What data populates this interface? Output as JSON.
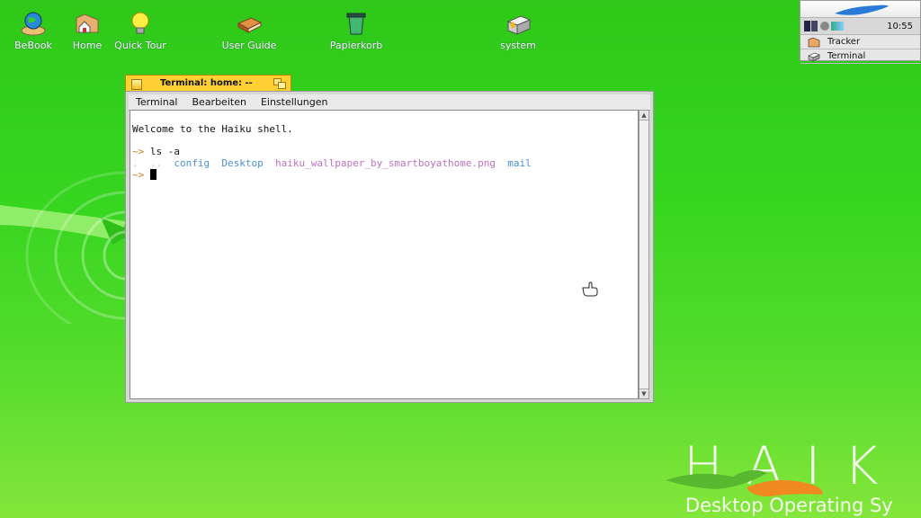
{
  "desktop": {
    "icons": [
      {
        "label": "BeBook",
        "icon": "globe-book-icon"
      },
      {
        "label": "Home",
        "icon": "home-folder-icon"
      },
      {
        "label": "Quick Tour",
        "icon": "lightbulb-icon"
      },
      {
        "label": "User Guide",
        "icon": "book-icon"
      },
      {
        "label": "Papierkorb",
        "icon": "trash-icon"
      },
      {
        "label": "system",
        "icon": "system-volume-icon"
      }
    ],
    "logo": {
      "big": "HAIK",
      "sub": "Desktop Operating Sy"
    }
  },
  "deskbar": {
    "clock": "10:55",
    "apps": [
      {
        "label": "Tracker",
        "icon": "tracker-icon"
      },
      {
        "label": "Terminal",
        "icon": "terminal-icon"
      }
    ]
  },
  "terminal": {
    "title": "Terminal: home: --",
    "menu": [
      "Terminal",
      "Bearbeiten",
      "Einstellungen"
    ],
    "welcome": "Welcome to the Haiku shell.",
    "prompt": "~>",
    "command": "ls -a",
    "listing": [
      {
        "name": ".",
        "color": "#c8b8c8"
      },
      {
        "name": "..",
        "color": "#c8b8c8"
      },
      {
        "name": "config",
        "color": "#4a90d0"
      },
      {
        "name": "Desktop",
        "color": "#4a90d0"
      },
      {
        "name": "haiku_wallpaper_by_smartboyathome.png",
        "color": "#c070c0"
      },
      {
        "name": "mail",
        "color": "#4a90d0"
      }
    ]
  },
  "colors": {
    "tab": "#ffd033",
    "prompt": "#c08020",
    "dir": "#4a90d0",
    "file": "#c070c0"
  }
}
